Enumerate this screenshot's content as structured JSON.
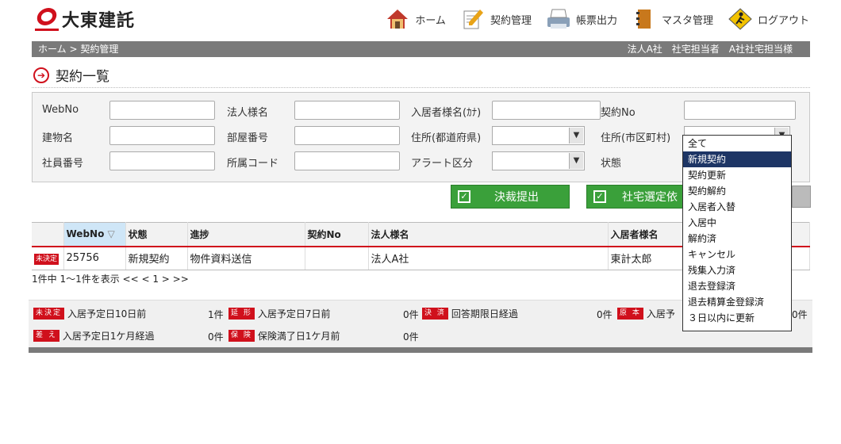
{
  "header": {
    "logo_text": "大東建託",
    "nav": [
      {
        "label": "ホーム",
        "icon": "house-icon"
      },
      {
        "label": "契約管理",
        "icon": "contract-pen-icon"
      },
      {
        "label": "帳票出力",
        "icon": "printer-icon"
      },
      {
        "label": "マスタ管理",
        "icon": "binder-icon"
      },
      {
        "label": "ログアウト",
        "icon": "logout-runner-icon"
      }
    ]
  },
  "breadcrumb": {
    "path": "ホーム > 契約管理",
    "user": "法人A社　社宅担当者　A社社宅担当様"
  },
  "page": {
    "title": "契約一覧"
  },
  "search": {
    "labels": {
      "webno": "WebNo",
      "corp_name": "法人様名",
      "resident_name": "入居者様名(ｶﾅ)",
      "contract_no": "契約No",
      "building": "建物名",
      "room": "部屋番号",
      "prefecture": "住所(都道府県)",
      "city": "住所(市区町村)",
      "employee_no": "社員番号",
      "dept_code": "所属コード",
      "alert_type": "アラート区分",
      "status": "状態"
    }
  },
  "actions": {
    "submit_label": "決裁提出",
    "request_label": "社宅選定依"
  },
  "table": {
    "columns": [
      "WebNo",
      "状態",
      "進捗",
      "契約No",
      "法人様名",
      "入居者様名"
    ],
    "rows": [
      {
        "badge": "未決定",
        "webno": "25756",
        "status": "新規契約",
        "progress": "物件資料送信",
        "contract_no": "",
        "corp": "法人A社",
        "resident": "東計太郎"
      }
    ]
  },
  "pager": {
    "text": "1件中 1～1件を表示  << < 1 > >>"
  },
  "alerts": [
    {
      "tag": "未決定",
      "label": "入居予定日10日前",
      "count": "1件"
    },
    {
      "tag": "延 形",
      "label": "入居予定日7日前",
      "count": "0件"
    },
    {
      "tag": "決 済",
      "label": "回答期限日経過",
      "count": "0件"
    },
    {
      "tag": "原 本",
      "label": "入居予",
      "count": "0件"
    },
    {
      "tag": "差 え",
      "label": "入居予定日1ケ月経過",
      "count": "0件"
    },
    {
      "tag": "保 険",
      "label": "保険満了日1ケ月前",
      "count": "0件"
    }
  ],
  "status_dropdown": {
    "options": [
      "全て",
      "新規契約",
      "契約更新",
      "契約解約",
      "入居者入替",
      "入居中",
      "解約済",
      "キャンセル",
      "残集入力済",
      "退去登録済",
      "退去精算金登録済",
      "３日以内に更新"
    ],
    "selected": "新規契約"
  },
  "colors": {
    "brand_red": "#d0101c",
    "bar_gray": "#7a7a7a",
    "button_green": "#3aa03a",
    "selected_blue": "#1d3565"
  }
}
